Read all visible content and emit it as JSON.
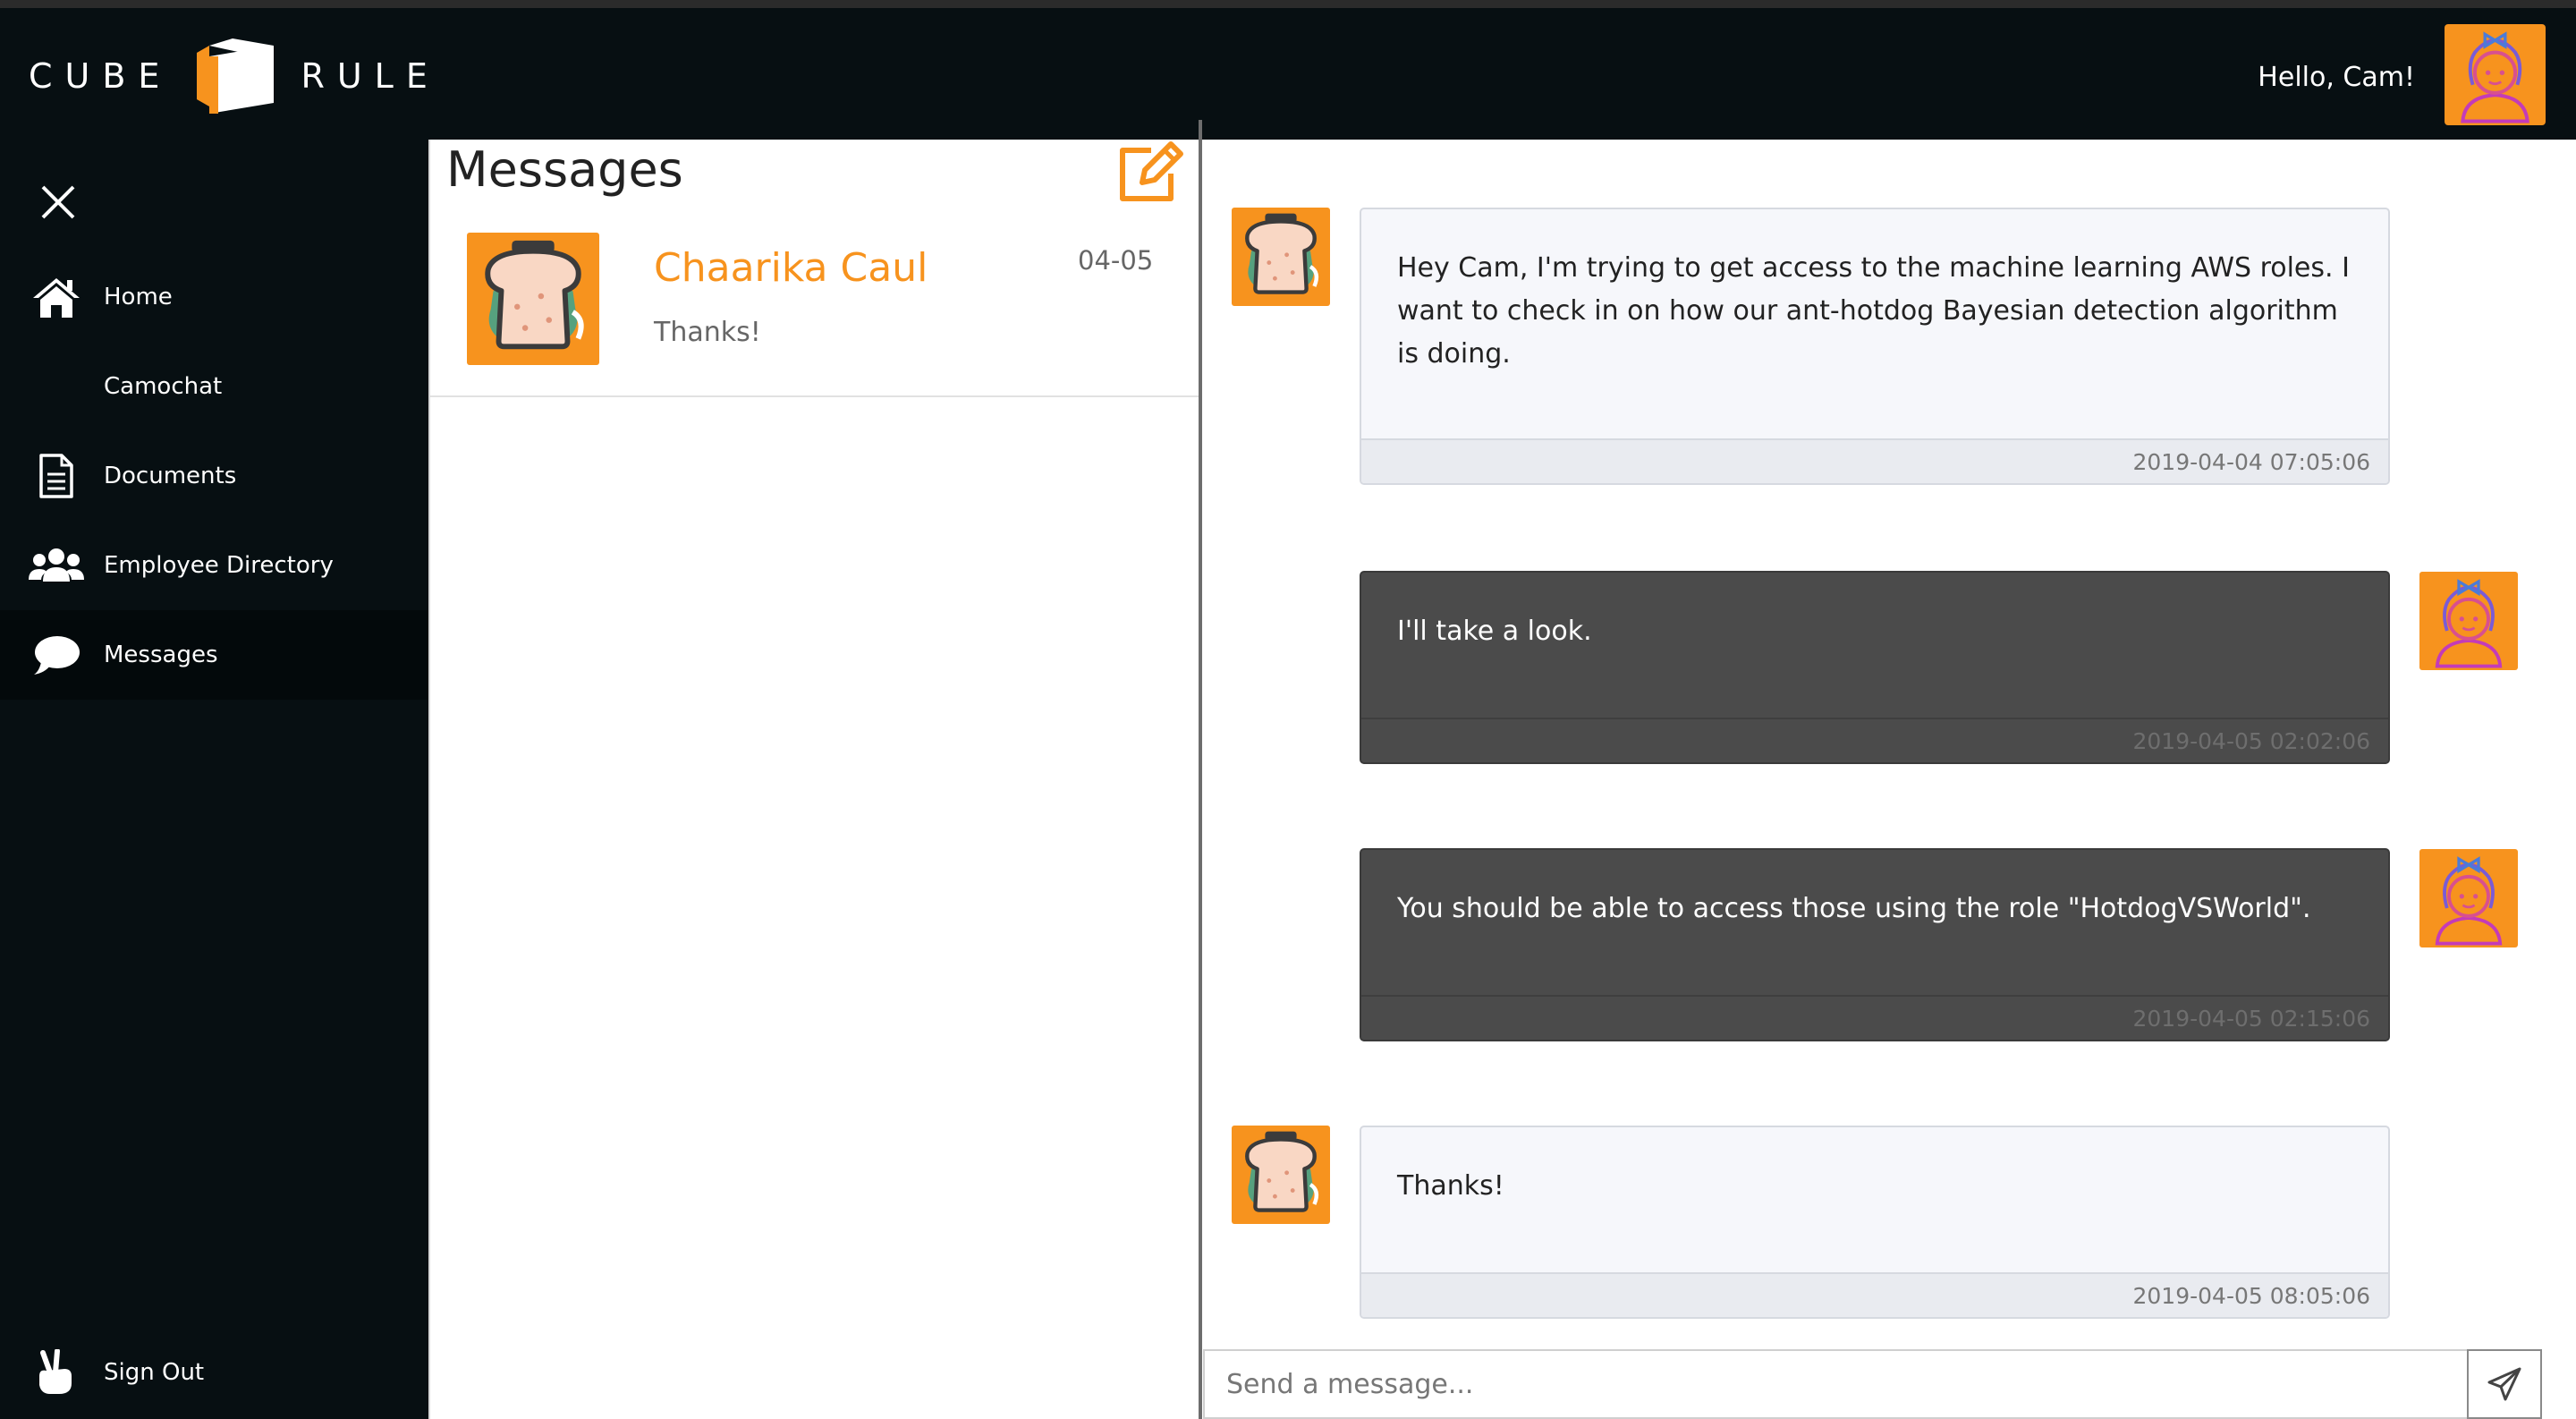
{
  "brand": {
    "left_word": "CUBE",
    "right_word": "RULE"
  },
  "header": {
    "greeting": "Hello, Cam!"
  },
  "sidebar": {
    "items": [
      {
        "label": "Home",
        "icon": "home-icon"
      },
      {
        "label": "Camochat",
        "icon": ""
      },
      {
        "label": "Documents",
        "icon": "document-icon"
      },
      {
        "label": "Employee Directory",
        "icon": "users-icon"
      },
      {
        "label": "Messages",
        "icon": "chat-bubble-icon",
        "active": true
      }
    ],
    "sign_out": {
      "label": "Sign Out",
      "icon": "peace-hand-icon"
    }
  },
  "messages_list": {
    "title": "Messages",
    "conversations": [
      {
        "name": "Chaarika Caul",
        "date": "04-05",
        "preview": "Thanks!"
      }
    ]
  },
  "chat": {
    "messages": [
      {
        "direction": "in",
        "text": "Hey Cam, I'm trying to get access to the machine learning AWS roles. I want to check in on how our ant-hotdog Bayesian detection algorithm is doing.",
        "time": "2019-04-04 07:05:06"
      },
      {
        "direction": "out",
        "text": "I'll take a look.",
        "time": "2019-04-05 02:02:06"
      },
      {
        "direction": "out",
        "text": "You should be able to access those using the role \"HotdogVSWorld\".",
        "time": "2019-04-05 02:15:06"
      },
      {
        "direction": "in",
        "text": "Thanks!",
        "time": "2019-04-05 08:05:06"
      }
    ],
    "composer": {
      "placeholder": "Send a message..."
    }
  },
  "colors": {
    "accent_orange": "#f7931e",
    "topbar_bg": "#070f12",
    "outgoing_bubble": "#4b4b4b",
    "incoming_bubble": "#f6f7fb"
  }
}
